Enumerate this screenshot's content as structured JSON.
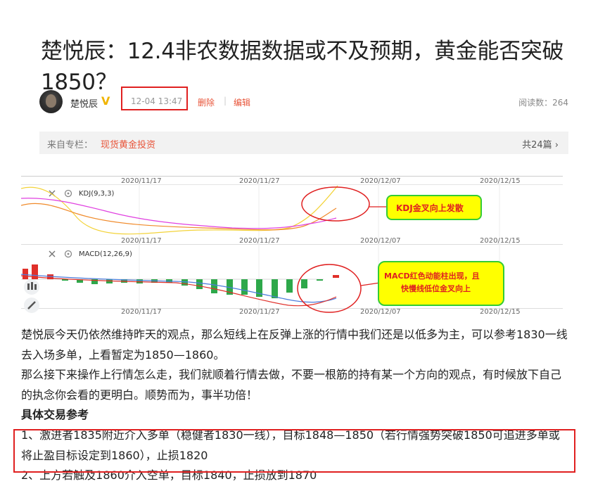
{
  "article": {
    "title": "楚悦辰：12.4非农数据数据或不及预期，黄金能否突破1850？"
  },
  "meta": {
    "author": "楚悦辰",
    "verified_badge": "V",
    "time": "12-04 13:47",
    "delete": "删除",
    "separator": "|",
    "edit": "编辑",
    "reads": "阅读数：264"
  },
  "column": {
    "from_label": "来自专栏：",
    "link": "现货黄金投资",
    "count": "共24篇 ›"
  },
  "chart": {
    "top_dates": [
      "2020/11/17",
      "2020/11/27",
      "2020/12/07",
      "2020/12/15"
    ],
    "mid_dates": [
      "2020/11/17",
      "2020/11/27",
      "2020/12/07",
      "2020/12/15"
    ],
    "bottom_dates": [
      "2020/11/17",
      "2020/11/27",
      "2020/12/07",
      "2020/12/15"
    ],
    "kdj_label": "KDJ(9,3,3)",
    "macd_label": "MACD(12,26,9)",
    "kdj_note": "KDJ金叉向上发散",
    "macd_note_line1": "MACD红色动能柱出现，且",
    "macd_note_line2": "快慢线低位金叉向上",
    "colors": {
      "up_bar": "#e0302a",
      "down_bar": "#2ea84a",
      "note_fill": "#ffff00",
      "note_border": "#33cc33",
      "note_text": "#e02020",
      "circle": "#e02020"
    }
  },
  "body": {
    "para1": "楚悦辰今天仍依然维持昨天的观点，那么短线上在反弹上涨的行情中我们还是以低多为主，可以参考1830一线去入场多单，上看暂定为1850—1860。",
    "para2": "那么接下来操作上行情怎么走，我们就顺着行情去做，不要一根筋的持有某一个方向的观点，有时候放下自己的执念你会看的更明白。顺势而为，事半功倍！",
    "heading": "具体交易参考",
    "item1": "1、激进者1835附近介入多单（稳健者1830一线），目标1848—1850（若行情强势突破1850可追进多单或将止盈目标设定到1860），止损1820",
    "item2": "2、上方若触及1860介入空单，目标1840，止损放到1870"
  }
}
